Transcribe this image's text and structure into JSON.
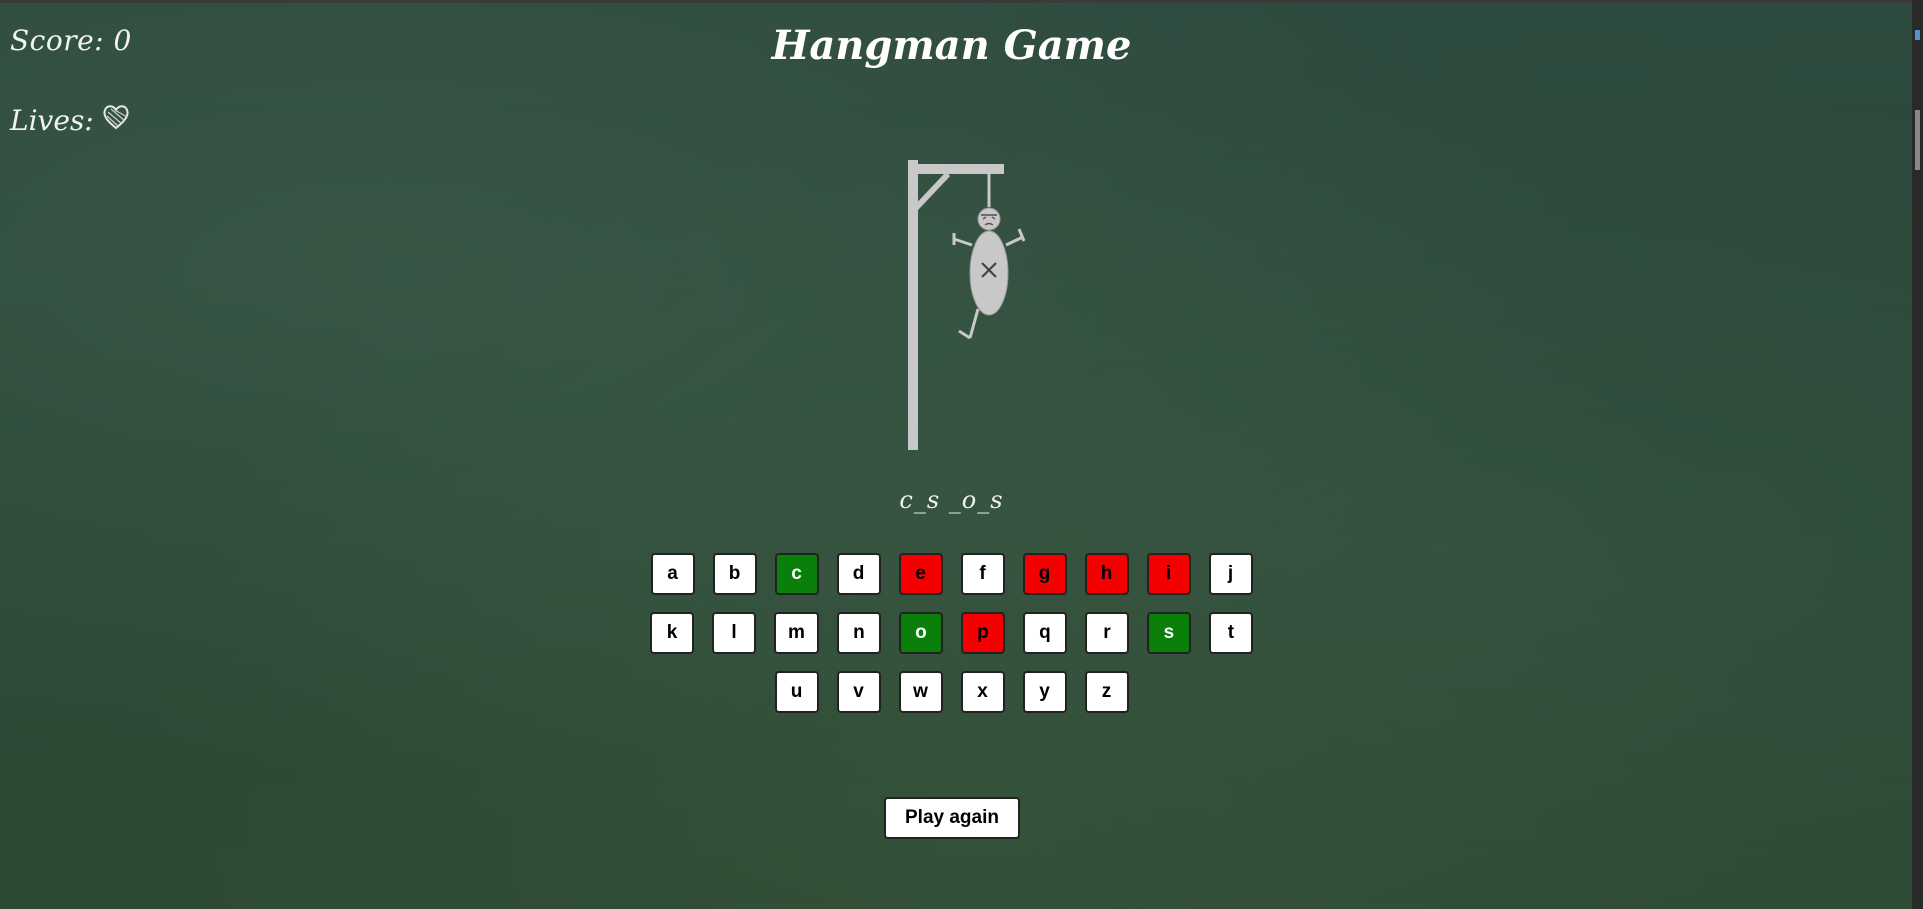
{
  "hud": {
    "score_label": "Score: 0",
    "lives_label": "Lives:",
    "lives_icon": "heart-icon"
  },
  "title": "Hangman Game",
  "word_display": "c_s _o_s",
  "keyboard": {
    "rows": [
      [
        {
          "letter": "a",
          "state": "unused"
        },
        {
          "letter": "b",
          "state": "unused"
        },
        {
          "letter": "c",
          "state": "correct"
        },
        {
          "letter": "d",
          "state": "unused"
        },
        {
          "letter": "e",
          "state": "wrong"
        },
        {
          "letter": "f",
          "state": "unused"
        },
        {
          "letter": "g",
          "state": "wrong"
        },
        {
          "letter": "h",
          "state": "wrong"
        },
        {
          "letter": "i",
          "state": "wrong"
        },
        {
          "letter": "j",
          "state": "unused"
        }
      ],
      [
        {
          "letter": "k",
          "state": "unused"
        },
        {
          "letter": "l",
          "state": "unused"
        },
        {
          "letter": "m",
          "state": "unused"
        },
        {
          "letter": "n",
          "state": "unused"
        },
        {
          "letter": "o",
          "state": "correct"
        },
        {
          "letter": "p",
          "state": "wrong"
        },
        {
          "letter": "q",
          "state": "unused"
        },
        {
          "letter": "r",
          "state": "unused"
        },
        {
          "letter": "s",
          "state": "correct"
        },
        {
          "letter": "t",
          "state": "unused"
        }
      ],
      [
        {
          "letter": "u",
          "state": "unused"
        },
        {
          "letter": "v",
          "state": "unused"
        },
        {
          "letter": "w",
          "state": "unused"
        },
        {
          "letter": "x",
          "state": "unused"
        },
        {
          "letter": "y",
          "state": "unused"
        },
        {
          "letter": "z",
          "state": "unused"
        }
      ]
    ]
  },
  "play_again_label": "Play again",
  "colors": {
    "background": "#2d4a3e",
    "correct": "#0a7f0a",
    "wrong": "#f50000",
    "key_default": "#ffffff",
    "gallows": "#c8c8c8"
  }
}
